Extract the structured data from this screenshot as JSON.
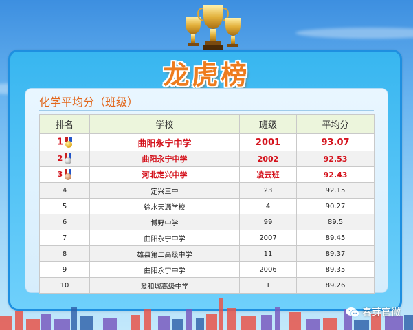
{
  "header": {
    "title": "龙虎榜"
  },
  "panel": {
    "subtitle": "化学平均分（班级）"
  },
  "table": {
    "columns": [
      "排名",
      "学校",
      "班级",
      "平均分"
    ],
    "rows": [
      {
        "rank": "1",
        "school": "曲阳永宁中学",
        "class": "2001",
        "avg": "93.07",
        "medal": "gold-medal-icon"
      },
      {
        "rank": "2",
        "school": "曲阳永宁中学",
        "class": "2002",
        "avg": "92.53",
        "medal": "silver-medal-icon"
      },
      {
        "rank": "3",
        "school": "河北定兴中学",
        "class": "凌云班",
        "avg": "92.43",
        "medal": "bronze-medal-icon"
      },
      {
        "rank": "4",
        "school": "定兴三中",
        "class": "23",
        "avg": "92.15"
      },
      {
        "rank": "5",
        "school": "徐水天源学校",
        "class": "4",
        "avg": "90.27"
      },
      {
        "rank": "6",
        "school": "博野中学",
        "class": "99",
        "avg": "89.5"
      },
      {
        "rank": "7",
        "school": "曲阳永宁中学",
        "class": "2007",
        "avg": "89.45"
      },
      {
        "rank": "8",
        "school": "雄县第二高级中学",
        "class": "11",
        "avg": "89.37"
      },
      {
        "rank": "9",
        "school": "曲阳永宁中学",
        "class": "2006",
        "avg": "89.35"
      },
      {
        "rank": "10",
        "school": "爱和城高级中学",
        "class": "1",
        "avg": "89.26"
      }
    ],
    "highlight_color": "#d4121c"
  },
  "watermark": {
    "text": "春芽官微",
    "icon": "wechat-icon"
  },
  "colors": {
    "title": "#ee7c1e",
    "frame": "#1e8fe0",
    "subtitle": "#e2661a"
  }
}
